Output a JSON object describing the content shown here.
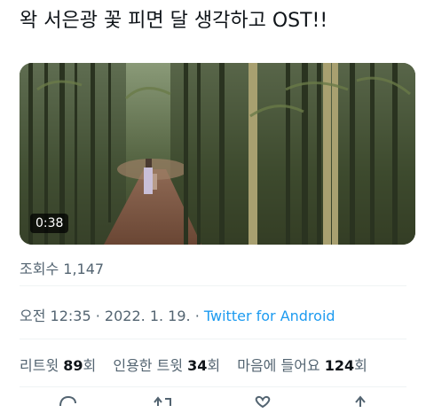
{
  "tweet": {
    "text": "왁 서은광 꽃 피면 달 생각하고 OST!!"
  },
  "video": {
    "duration": "0:38",
    "scene": "bamboo-forest-path"
  },
  "views": {
    "label": "조회수",
    "count": "1,147"
  },
  "meta": {
    "time": "오전 12:35",
    "sep1": "·",
    "date": "2022. 1. 19.",
    "sep2": "·",
    "source": "Twitter for Android"
  },
  "stats": {
    "retweets_label": "리트윗",
    "retweets_count": "89",
    "retweets_unit": "회",
    "quotes_label": "인용한 트윗",
    "quotes_count": "34",
    "quotes_unit": "회",
    "likes_label": "마음에 들어요",
    "likes_count": "124",
    "likes_unit": "회"
  },
  "actions": {
    "icons": [
      "reply-icon",
      "retweet-icon",
      "like-icon",
      "share-icon"
    ]
  },
  "colors": {
    "link": "#1d9bf0",
    "secondary_text": "#536471",
    "primary_text": "#0f1419",
    "divider": "#eff3f4"
  }
}
